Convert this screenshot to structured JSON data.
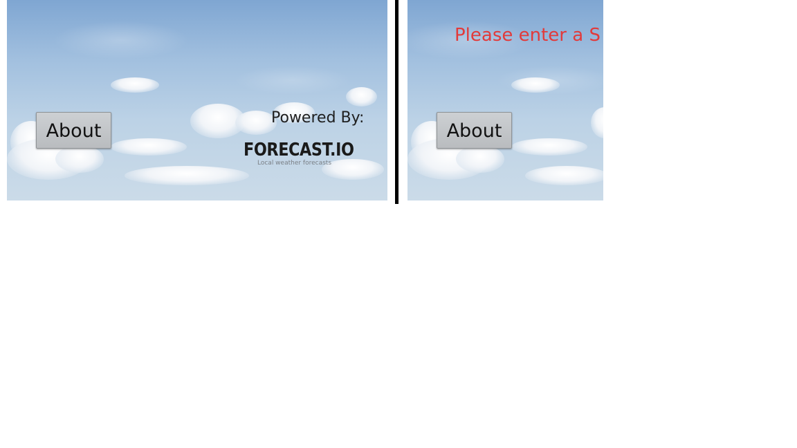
{
  "left_screen": {
    "about_button": "About",
    "powered_by": "Powered By:",
    "forecast_logo": "FORECAST.IO",
    "forecast_tagline": "Local weather forecasts"
  },
  "right_screen": {
    "error_message": "Please enter a S",
    "about_button": "About"
  },
  "colors": {
    "error_text": "#e23a3a",
    "divider": "#000000",
    "button_face": "#c4c7ca"
  }
}
